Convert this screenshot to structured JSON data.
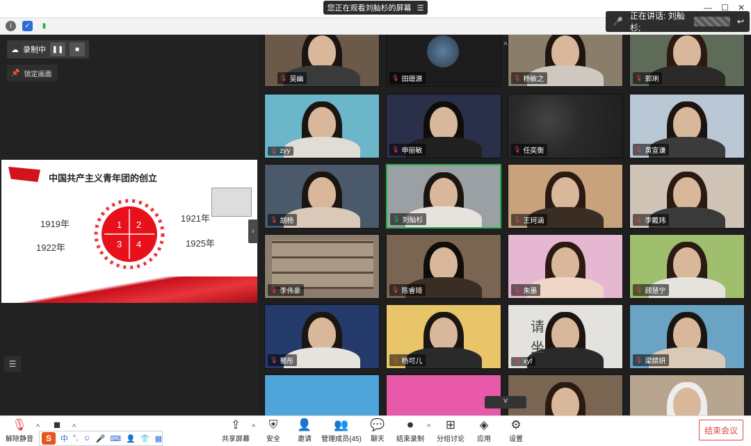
{
  "titlebar": {
    "share_text": "您正在观看刘舢杉的屏幕",
    "share_menu_icon": "menu-icon"
  },
  "speaking": {
    "label": "正在讲话: 刘舢杉;"
  },
  "recording": {
    "label": "录制中"
  },
  "lock_view": {
    "label": "锁定画面"
  },
  "slide": {
    "title": "中国共产主义青年团的创立",
    "years": [
      "1919年",
      "1922年",
      "1921年",
      "1925年"
    ],
    "quadrants": [
      "1",
      "2",
      "3",
      "4"
    ],
    "colors": {
      "accent": "#d4121b"
    }
  },
  "participants": [
    {
      "name": "吴幽",
      "mic": "muted",
      "bg": "#6b5a4a",
      "hair": "#1b1512",
      "body": "#3a3a3a",
      "badge": true
    },
    {
      "name": "田璟源",
      "mic": "muted",
      "bg": "#1c1c1c",
      "hair": "#1c1c1c",
      "body": "#1c1c1c",
      "avatar": true
    },
    {
      "name": "杨敏之",
      "mic": "muted",
      "bg": "#8a7d6a",
      "hair": "#20160f",
      "body": "#cfc8c0"
    },
    {
      "name": "郭琍",
      "mic": "muted",
      "bg": "#5f6b59",
      "hair": "#2a1a12",
      "body": "#2c2a28"
    },
    {
      "name": "zyy",
      "mic": "muted",
      "bg": "#6bb7c9",
      "hair": "#1b1512",
      "body": "#e0dcd6"
    },
    {
      "name": "申丽敏",
      "mic": "muted",
      "bg": "#2a2f4a",
      "hair": "#0f0c0a",
      "body": "#202020"
    },
    {
      "name": "任奕衡",
      "mic": "muted",
      "bg": "#2c2c2c",
      "hair": "#2c2c2c",
      "body": "#3a3a3a",
      "blur": true
    },
    {
      "name": "黄宣谦",
      "mic": "muted",
      "bg": "#b9c8d4",
      "hair": "#1b1512",
      "body": "#3b3b3b"
    },
    {
      "name": "胡杨",
      "mic": "muted",
      "bg": "#4a5a6a",
      "hair": "#1b1512",
      "body": "#d9c9b8"
    },
    {
      "name": "刘舢杉",
      "mic": "active",
      "bg": "#9aa0a3",
      "hair": "#1b1512",
      "body": "#e6e2de"
    },
    {
      "name": "王珂涵",
      "mic": "muted",
      "bg": "#c8a27c",
      "hair": "#2a1a12",
      "body": "#3a2d24"
    },
    {
      "name": "李戴玮",
      "mic": "muted",
      "bg": "#cfc4b6",
      "hair": "#2a1a12",
      "body": "#3a3a3a"
    },
    {
      "name": "李伟豪",
      "mic": "muted",
      "bg": "#8c7d6c",
      "hair": "#8c7d6c",
      "body": "#8c7d6c",
      "shelf": true
    },
    {
      "name": "陈睿琦",
      "mic": "muted",
      "bg": "#7a6552",
      "hair": "#0f0c0a",
      "body": "#3a2d24"
    },
    {
      "name": "朱墨",
      "mic": "muted",
      "bg": "#e6b7d0",
      "hair": "#2a1a12",
      "body": "#efd6c6"
    },
    {
      "name": "顾慧宁",
      "mic": "muted",
      "bg": "#9fbf6e",
      "hair": "#2a1a12",
      "body": "#e6e2de"
    },
    {
      "name": "葡彤",
      "mic": "muted",
      "bg": "#243a6a",
      "hair": "#1b1512",
      "body": "#e6e2de"
    },
    {
      "name": "杨可儿",
      "mic": "muted",
      "bg": "#e9c56a",
      "hair": "#1b1512",
      "body": "#2a2a2a"
    },
    {
      "name": "xyf",
      "mic": "muted",
      "bg": "#e4e2df",
      "hair": "#1b1512",
      "body": "#2a2a2a",
      "sign": "请 坐"
    },
    {
      "name": "梁婧妍",
      "mic": "muted",
      "bg": "#6aa3c4",
      "hair": "#1b1512",
      "body": "#d9c9b8"
    },
    {
      "name": "",
      "mic": "none",
      "bg": "#4fa5d9",
      "hair": "#4fa5d9",
      "body": "#4fa5d9"
    },
    {
      "name": "",
      "mic": "none",
      "bg": "#e85aa9",
      "hair": "#e85aa9",
      "body": "#e85aa9"
    },
    {
      "name": "",
      "mic": "none",
      "bg": "#7a6552",
      "hair": "#2a1a12",
      "body": "#3a2d24"
    },
    {
      "name": "",
      "mic": "none",
      "bg": "#b7a58f",
      "hair": "#ededed",
      "body": "#d9c9b8"
    }
  ],
  "bottombar": {
    "unmute": "解除静音",
    "share": "共享屏幕",
    "security": "安全",
    "invite": "邀请",
    "members": "管理成员(45)",
    "chat": "聊天",
    "end_record": "结束录制",
    "breakout": "分组讨论",
    "apps": "应用",
    "settings": "设置",
    "end_meeting": "结束会议"
  },
  "ime": {
    "logo": "S",
    "lang": "中"
  },
  "colors": {
    "end": "#e04545",
    "active_border": "#22b14c"
  }
}
